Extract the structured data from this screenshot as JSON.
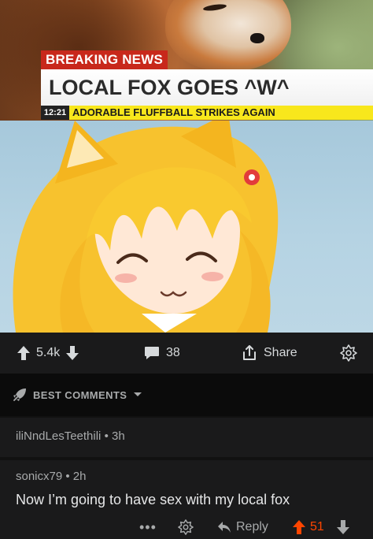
{
  "meme": {
    "breaking_label": "BREAKING NEWS",
    "headline": "LOCAL FOX GOES ^W^",
    "ticker_time": "12:21",
    "ticker_text": "ADORABLE FLUFFBALL STRIKES AGAIN"
  },
  "post_actions": {
    "upvotes": "5.4k",
    "comments": "38",
    "share_label": "Share"
  },
  "sort": {
    "label": "BEST COMMENTS"
  },
  "comments": [
    {
      "author": "iliNndLesTeethili",
      "age": "3h"
    },
    {
      "author": "sonicx79",
      "age": "2h",
      "body": "Now I’m going to have sex with my local fox",
      "more": "•••",
      "reply_label": "Reply",
      "score": "51"
    }
  ],
  "colors": {
    "upvote_active": "#ff4500",
    "background": "#1a1a1b",
    "breaking_red": "#c8281b",
    "ticker_yellow": "#f8e71c"
  },
  "icons": [
    "upvote-icon",
    "downvote-icon",
    "comment-icon",
    "share-icon",
    "award-icon",
    "sort-rocket-icon",
    "chevron-down-icon",
    "reply-icon",
    "more-icon"
  ]
}
